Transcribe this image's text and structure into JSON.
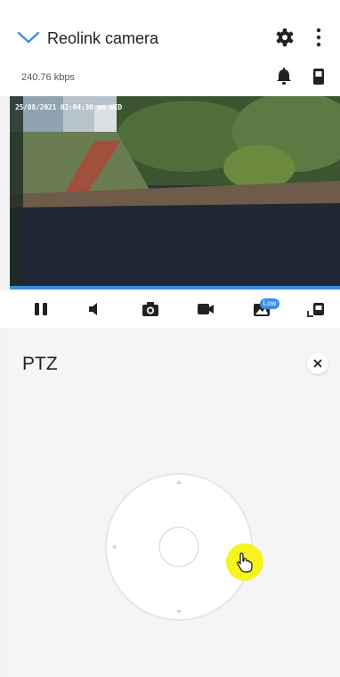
{
  "header": {
    "title": "Reolink camera",
    "bitrate": "240.76 kbps",
    "icons": [
      "chevron-down-icon",
      "gear-icon",
      "more-vertical-icon",
      "bell-icon",
      "phone-icon"
    ]
  },
  "video": {
    "overlay_timestamp": "25/08/2021 02:04:30 pm WED"
  },
  "controls": {
    "icons": [
      "pause-icon",
      "speaker-icon",
      "camera-icon",
      "record-icon",
      "quality-icon",
      "fullscreen-icon"
    ],
    "quality_badge": "Low"
  },
  "ptz": {
    "title": "PTZ",
    "close_icon": "close-icon"
  },
  "colors": {
    "accent": "#3a8ee6",
    "highlight": "#f7f31f",
    "background": "#f4f4f6"
  }
}
